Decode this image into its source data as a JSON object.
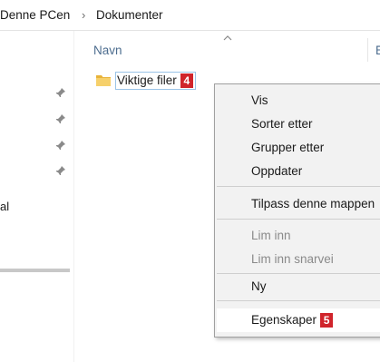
{
  "breadcrumb": {
    "pc": "Denne PCen",
    "separator": "›",
    "documents": "Dokumenter"
  },
  "nav_pane": {
    "partial_label": "al",
    "pinned_count": 4
  },
  "file_list": {
    "column_name": "Navn",
    "column_next_partial": "E",
    "items": [
      {
        "name": "Viktige filer",
        "step_badge": "4"
      }
    ]
  },
  "context_menu": {
    "items": [
      {
        "label": "Vis",
        "enabled": true
      },
      {
        "label": "Sorter etter",
        "enabled": true
      },
      {
        "label": "Grupper etter",
        "enabled": true
      },
      {
        "label": "Oppdater",
        "enabled": true
      },
      {
        "label": "Tilpass denne mappen",
        "enabled": true
      },
      {
        "label": "Lim inn",
        "enabled": false
      },
      {
        "label": "Lim inn snarvei",
        "enabled": false
      },
      {
        "label": "Ny",
        "enabled": true
      },
      {
        "label": "Egenskaper",
        "enabled": true,
        "step_badge": "5",
        "highlighted": true
      }
    ]
  },
  "colors": {
    "badge": "#d0242b",
    "header_text": "#4d6d8f",
    "menu_bg": "#f2f2f2",
    "folder": "#f3c54a"
  },
  "icons": [
    "pin-icon",
    "folder-icon",
    "sort-up-icon"
  ]
}
